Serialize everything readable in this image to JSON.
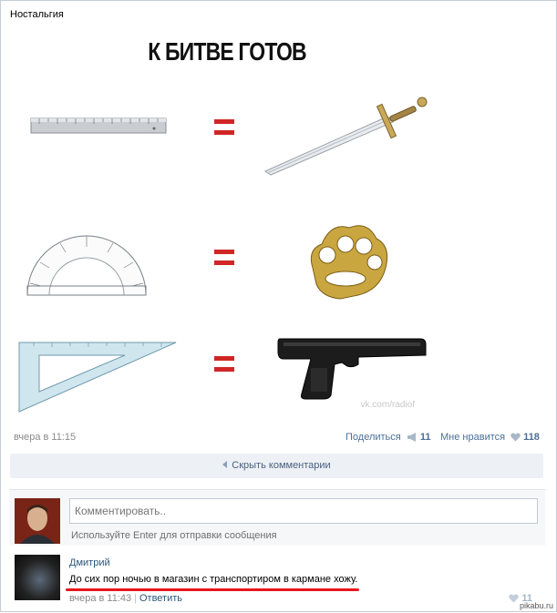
{
  "post": {
    "source": "Ностальгия",
    "meme": {
      "title": "К БИТВЕ ГОТОВ",
      "watermark": "vk.com/radiof",
      "rows": [
        {
          "left": "ruler-icon",
          "right": "sword-icon"
        },
        {
          "left": "protractor-icon",
          "right": "brass-knuckles-icon"
        },
        {
          "left": "set-square-icon",
          "right": "pistol-icon"
        }
      ]
    },
    "date": "вчера в 11:15",
    "share_label": "Поделиться",
    "share_count": "11",
    "like_label": "Мне нравится",
    "like_count": "118"
  },
  "comments_toggle": "Скрыть комментарии",
  "composer": {
    "placeholder": "Комментировать..",
    "hint": "Используйте Enter для отправки сообщения"
  },
  "comment": {
    "author": "Дмитрий",
    "text": "До сих пор ночью в магазин с транспортиром в кармане хожу.",
    "time": "вчера в 11:43",
    "reply_label": "Ответить",
    "likes": "11"
  },
  "watermark": "pikabu.ru",
  "colors": {
    "link": "#2b587a",
    "accent_bar": "#edf1f5",
    "equals": "#d02626",
    "underline": "#e8161c"
  }
}
